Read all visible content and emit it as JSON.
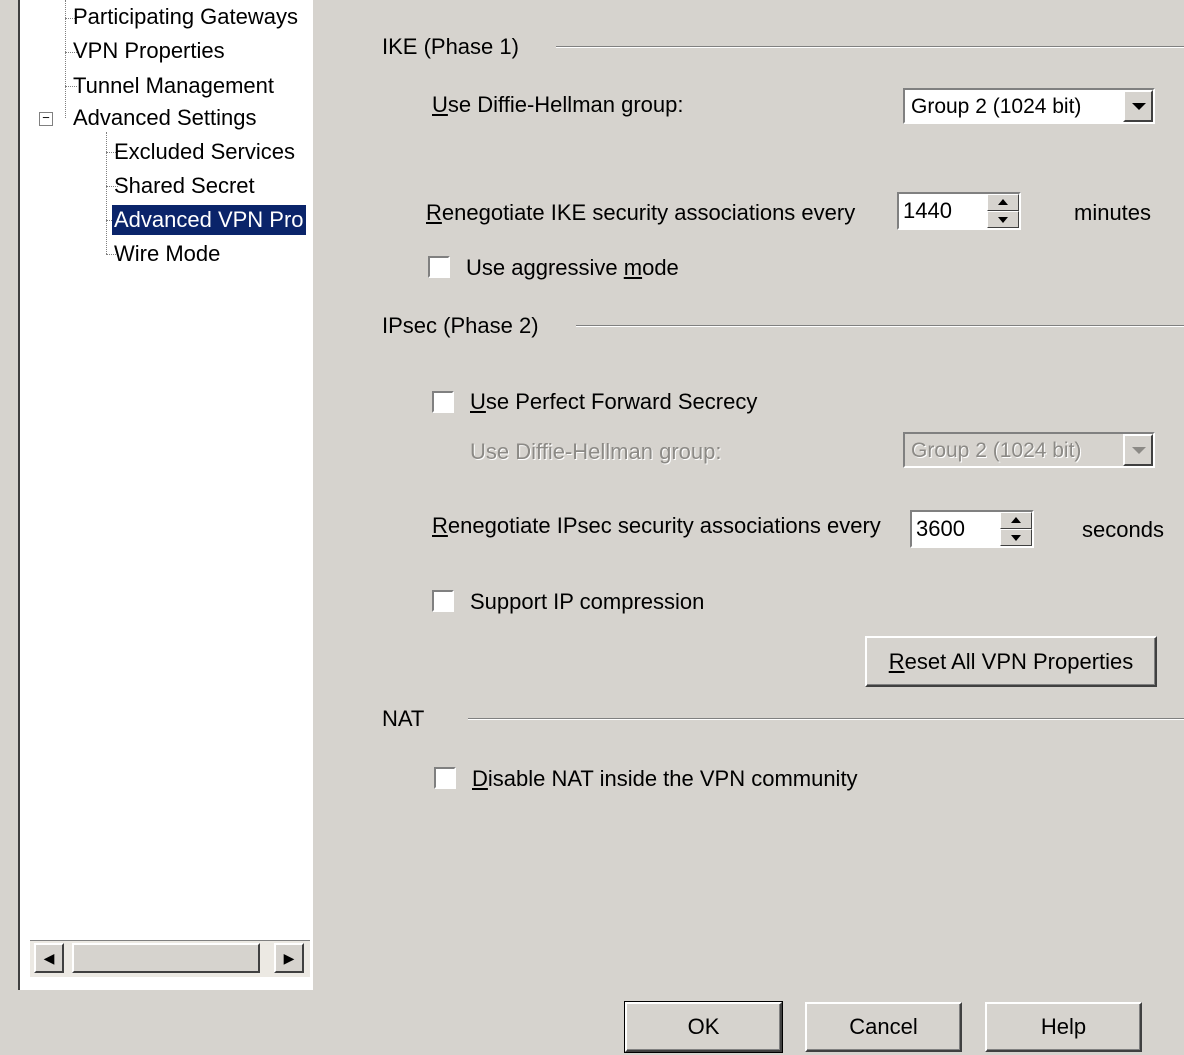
{
  "tree": {
    "items": [
      {
        "label": "Participating Gateways"
      },
      {
        "label": "VPN Properties"
      },
      {
        "label": "Tunnel Management"
      },
      {
        "label": "Advanced Settings",
        "expander": "−"
      },
      {
        "label": "Excluded Services"
      },
      {
        "label": "Shared Secret"
      },
      {
        "label": "Advanced VPN Pro"
      },
      {
        "label": "Wire Mode"
      }
    ],
    "selected_index": 6
  },
  "ike": {
    "title": "IKE (Phase 1)",
    "dh_label_u": "U",
    "dh_label_rest": "se Diffie-Hellman group:",
    "dh_value": "Group 2 (1024 bit)",
    "reneg_label_u": "R",
    "reneg_label_rest": "enegotiate IKE security associations every",
    "reneg_value": "1440",
    "reneg_unit": "minutes",
    "aggressive_pre": "Use aggressive ",
    "aggressive_u": "m",
    "aggressive_post": "ode",
    "aggressive_checked": false
  },
  "ipsec": {
    "title": "IPsec (Phase 2)",
    "pfs_u": "U",
    "pfs_rest": "se Perfect Forward Secrecy",
    "pfs_checked": false,
    "dh_label": "Use Diffie-Hellman group:",
    "dh_value": "Group 2 (1024 bit)",
    "reneg_label_u": "R",
    "reneg_label_rest": "enegotiate IPsec security associations every",
    "reneg_value": "3600",
    "reneg_unit": "seconds",
    "compression_label": "Support IP compression",
    "compression_checked": false,
    "reset_u": "R",
    "reset_rest": "eset All VPN Properties"
  },
  "nat": {
    "title": "NAT",
    "disable_u": "D",
    "disable_rest": "isable NAT inside the VPN community",
    "disable_checked": false
  },
  "footer": {
    "ok": "OK",
    "cancel": "Cancel",
    "help": "Help"
  },
  "icons": {
    "scroll_left": "◀",
    "scroll_right": "▶"
  }
}
